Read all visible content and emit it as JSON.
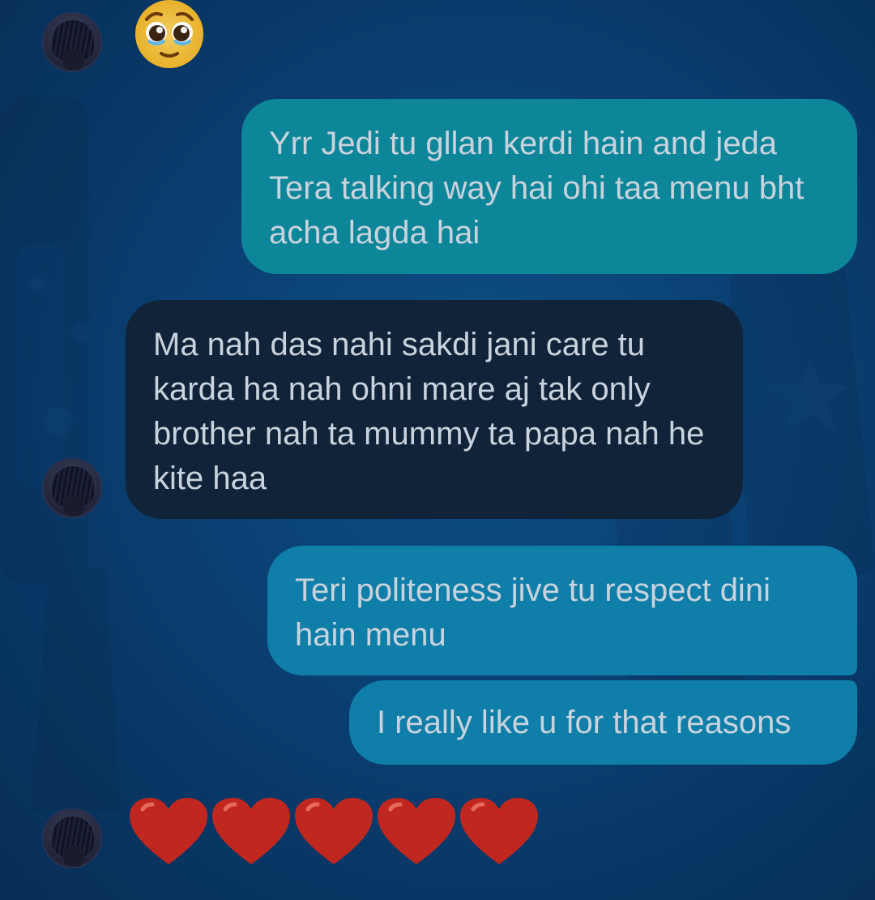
{
  "conversation": {
    "messages": [
      {
        "sender": "other",
        "type": "emoji",
        "emoji": "🥹",
        "icon": "pleading-face-emoji"
      },
      {
        "sender": "me",
        "type": "text",
        "text": "Yrr Jedi tu gllan kerdi hain and jeda Tera talking way hai ohi taa menu bht acha lagda hai"
      },
      {
        "sender": "other",
        "type": "text",
        "text": "Ma nah das nahi sakdi jani care tu karda ha nah ohni mare aj tak only brother nah ta mummy ta papa nah he kite haa"
      },
      {
        "sender": "me",
        "type": "text",
        "text": "Teri politeness jive tu respect dini hain menu"
      },
      {
        "sender": "me",
        "type": "text",
        "text": "I really like u for that reasons"
      },
      {
        "sender": "other",
        "type": "emoji",
        "emoji": "❤❤❤❤❤",
        "icon": "red-heart-emoji",
        "count": 5
      }
    ]
  },
  "colors": {
    "background": "#0a3f72",
    "sent_bubble_top": "#0d8699",
    "sent_bubble": "#0f7ea8",
    "received_bubble": "#112339",
    "text": "#c9d3dd",
    "heart": "#c0271f"
  }
}
